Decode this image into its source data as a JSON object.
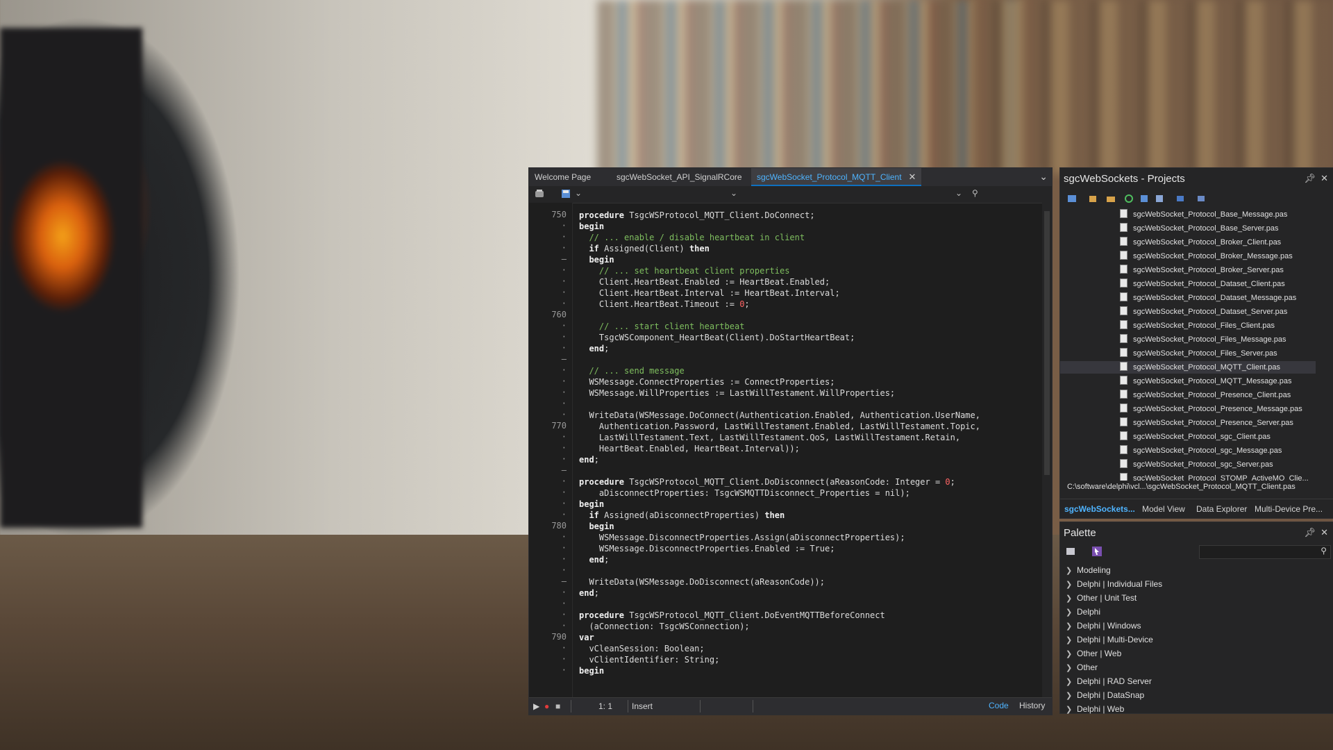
{
  "editor": {
    "tabs": [
      {
        "label": "Welcome Page"
      },
      {
        "label": "sgcWebSocket_API_SignalRCore"
      },
      {
        "label": "sgcWebSocket_Protocol_MQTT_Client",
        "active": true
      }
    ],
    "gutter": [
      {
        "n": "750"
      },
      {
        "n": "·"
      },
      {
        "n": "·"
      },
      {
        "n": "·"
      },
      {
        "n": "–"
      },
      {
        "n": "·"
      },
      {
        "n": "·"
      },
      {
        "n": "·"
      },
      {
        "n": "·"
      },
      {
        "n": "760"
      },
      {
        "n": "·"
      },
      {
        "n": "·"
      },
      {
        "n": "·"
      },
      {
        "n": "–"
      },
      {
        "n": "·"
      },
      {
        "n": "·"
      },
      {
        "n": "·"
      },
      {
        "n": "·"
      },
      {
        "n": "·"
      },
      {
        "n": "770"
      },
      {
        "n": "·"
      },
      {
        "n": "·"
      },
      {
        "n": "·"
      },
      {
        "n": "–"
      },
      {
        "n": "·"
      },
      {
        "n": "·"
      },
      {
        "n": "·"
      },
      {
        "n": "·"
      },
      {
        "n": "780"
      },
      {
        "n": "·"
      },
      {
        "n": "·"
      },
      {
        "n": "·"
      },
      {
        "n": "·"
      },
      {
        "n": "–"
      },
      {
        "n": "·"
      },
      {
        "n": "·"
      },
      {
        "n": "·"
      },
      {
        "n": "·"
      },
      {
        "n": "790"
      },
      {
        "n": "·"
      },
      {
        "n": "·"
      },
      {
        "n": "·"
      }
    ],
    "code_lines": [
      [
        {
          "t": "procedure",
          "c": "kw"
        },
        {
          "t": " TsgcWSProtocol_MQTT_Client.DoConnect;",
          "c": ""
        }
      ],
      [
        {
          "t": "begin",
          "c": "kw"
        }
      ],
      [
        {
          "t": "  // ... enable / disable heartbeat in client",
          "c": "cm"
        }
      ],
      [
        {
          "t": "  ",
          "c": ""
        },
        {
          "t": "if",
          "c": "kw"
        },
        {
          "t": " Assigned(Client) ",
          "c": ""
        },
        {
          "t": "then",
          "c": "kw"
        }
      ],
      [
        {
          "t": "  ",
          "c": ""
        },
        {
          "t": "begin",
          "c": "kw"
        }
      ],
      [
        {
          "t": "    // ... set heartbeat client properties",
          "c": "cm"
        }
      ],
      [
        {
          "t": "    Client.HeartBeat.Enabled := HeartBeat.Enabled;",
          "c": ""
        }
      ],
      [
        {
          "t": "    Client.HeartBeat.Interval := HeartBeat.Interval;",
          "c": ""
        }
      ],
      [
        {
          "t": "    Client.HeartBeat.Timeout := ",
          "c": ""
        },
        {
          "t": "0",
          "c": "num"
        },
        {
          "t": ";",
          "c": ""
        }
      ],
      [
        {
          "t": "",
          "c": ""
        }
      ],
      [
        {
          "t": "    // ... start client heartbeat",
          "c": "cm"
        }
      ],
      [
        {
          "t": "    TsgcWSComponent_HeartBeat(Client).DoStartHeartBeat;",
          "c": ""
        }
      ],
      [
        {
          "t": "  ",
          "c": ""
        },
        {
          "t": "end",
          "c": "kw"
        },
        {
          "t": ";",
          "c": ""
        }
      ],
      [
        {
          "t": "",
          "c": ""
        }
      ],
      [
        {
          "t": "  // ... send message",
          "c": "cm"
        }
      ],
      [
        {
          "t": "  WSMessage.ConnectProperties := ConnectProperties;",
          "c": ""
        }
      ],
      [
        {
          "t": "  WSMessage.WillProperties := LastWillTestament.WillProperties;",
          "c": ""
        }
      ],
      [
        {
          "t": "",
          "c": ""
        }
      ],
      [
        {
          "t": "  WriteData(WSMessage.DoConnect(Authentication.Enabled, Authentication.UserName,",
          "c": ""
        }
      ],
      [
        {
          "t": "    Authentication.Password, LastWillTestament.Enabled, LastWillTestament.Topic,",
          "c": ""
        }
      ],
      [
        {
          "t": "    LastWillTestament.Text, LastWillTestament.QoS, LastWillTestament.Retain,",
          "c": ""
        }
      ],
      [
        {
          "t": "    HeartBeat.Enabled, HeartBeat.Interval));",
          "c": ""
        }
      ],
      [
        {
          "t": "end",
          "c": "kw"
        },
        {
          "t": ";",
          "c": ""
        }
      ],
      [
        {
          "t": "",
          "c": ""
        }
      ],
      [
        {
          "t": "procedure",
          "c": "kw"
        },
        {
          "t": " TsgcWSProtocol_MQTT_Client.DoDisconnect(aReasonCode: Integer = ",
          "c": ""
        },
        {
          "t": "0",
          "c": "num"
        },
        {
          "t": ";",
          "c": ""
        }
      ],
      [
        {
          "t": "    aDisconnectProperties: TsgcWSMQTTDisconnect_Properties = nil);",
          "c": ""
        }
      ],
      [
        {
          "t": "begin",
          "c": "kw"
        }
      ],
      [
        {
          "t": "  ",
          "c": ""
        },
        {
          "t": "if",
          "c": "kw"
        },
        {
          "t": " Assigned(aDisconnectProperties) ",
          "c": ""
        },
        {
          "t": "then",
          "c": "kw"
        }
      ],
      [
        {
          "t": "  ",
          "c": ""
        },
        {
          "t": "begin",
          "c": "kw"
        }
      ],
      [
        {
          "t": "    WSMessage.DisconnectProperties.Assign(aDisconnectProperties);",
          "c": ""
        }
      ],
      [
        {
          "t": "    WSMessage.DisconnectProperties.Enabled := True;",
          "c": ""
        }
      ],
      [
        {
          "t": "  ",
          "c": ""
        },
        {
          "t": "end",
          "c": "kw"
        },
        {
          "t": ";",
          "c": ""
        }
      ],
      [
        {
          "t": "",
          "c": ""
        }
      ],
      [
        {
          "t": "  WriteData(WSMessage.DoDisconnect(aReasonCode));",
          "c": ""
        }
      ],
      [
        {
          "t": "end",
          "c": "kw"
        },
        {
          "t": ";",
          "c": ""
        }
      ],
      [
        {
          "t": "",
          "c": ""
        }
      ],
      [
        {
          "t": "procedure",
          "c": "kw"
        },
        {
          "t": " TsgcWSProtocol_MQTT_Client.DoEventMQTTBeforeConnect",
          "c": ""
        }
      ],
      [
        {
          "t": "  (aConnection: TsgcWSConnection);",
          "c": ""
        }
      ],
      [
        {
          "t": "var",
          "c": "kw"
        }
      ],
      [
        {
          "t": "  vCleanSession: Boolean;",
          "c": ""
        }
      ],
      [
        {
          "t": "  vClientIdentifier: String;",
          "c": ""
        }
      ],
      [
        {
          "t": "begin",
          "c": "kw"
        }
      ]
    ],
    "status": {
      "position": "1:  1",
      "mode": "Insert",
      "tab_code": "Code",
      "tab_history": "History"
    }
  },
  "projects": {
    "title": "sgcWebSockets - Projects",
    "files": [
      "sgcWebSocket_Protocol_Base_Message.pas",
      "sgcWebSocket_Protocol_Base_Server.pas",
      "sgcWebSocket_Protocol_Broker_Client.pas",
      "sgcWebSocket_Protocol_Broker_Message.pas",
      "sgcWebSocket_Protocol_Broker_Server.pas",
      "sgcWebSocket_Protocol_Dataset_Client.pas",
      "sgcWebSocket_Protocol_Dataset_Message.pas",
      "sgcWebSocket_Protocol_Dataset_Server.pas",
      "sgcWebSocket_Protocol_Files_Client.pas",
      "sgcWebSocket_Protocol_Files_Message.pas",
      "sgcWebSocket_Protocol_Files_Server.pas",
      "sgcWebSocket_Protocol_MQTT_Client.pas",
      "sgcWebSocket_Protocol_MQTT_Message.pas",
      "sgcWebSocket_Protocol_Presence_Client.pas",
      "sgcWebSocket_Protocol_Presence_Message.pas",
      "sgcWebSocket_Protocol_Presence_Server.pas",
      "sgcWebSocket_Protocol_sgc_Client.pas",
      "sgcWebSocket_Protocol_sgc_Message.pas",
      "sgcWebSocket_Protocol_sgc_Server.pas",
      "sgcWebSocket_Protocol_STOMP_ActiveMQ_Clie..."
    ],
    "selected_file": "sgcWebSocket_Protocol_MQTT_Client.pas",
    "path": "C:\\software\\delphi\\vcl...\\sgcWebSocket_Protocol_MQTT_Client.pas",
    "bottom_tabs": [
      "sgcWebSockets...",
      "Model View",
      "Data Explorer",
      "Multi-Device Pre..."
    ]
  },
  "palette": {
    "title": "Palette",
    "categories": [
      "Modeling",
      "Delphi | Individual Files",
      "Other | Unit Test",
      "Delphi",
      "Delphi | Windows",
      "Delphi | Multi-Device",
      "Other | Web",
      "Other",
      "Delphi | RAD Server",
      "Delphi | DataSnap",
      "Delphi | Web"
    ]
  },
  "colors": {
    "accent": "#4fb4ff",
    "editor_bg": "#1e1e1e",
    "panel_bg": "#252526",
    "comment": "#7fbf5f",
    "number": "#ff6464"
  }
}
